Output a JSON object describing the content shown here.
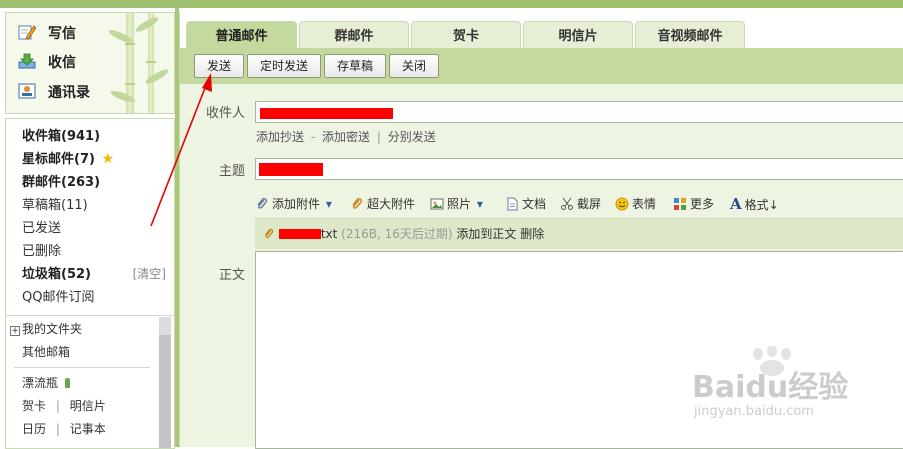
{
  "sidebar": {
    "quick": [
      {
        "label": "写信",
        "icon": "pencil-paper-icon"
      },
      {
        "label": "收信",
        "icon": "inbox-download-icon"
      },
      {
        "label": "通讯录",
        "icon": "contacts-card-icon"
      }
    ],
    "folders": [
      {
        "label": "收件箱(941)",
        "bold": true
      },
      {
        "label": "星标邮件(7)",
        "bold": true,
        "icon": "star-icon"
      },
      {
        "label": "群邮件(263)",
        "bold": true
      },
      {
        "label": "草稿箱(11)",
        "bold": false
      },
      {
        "label": "已发送",
        "bold": false
      },
      {
        "label": "已删除",
        "bold": false
      },
      {
        "label": "垃圾箱(52)",
        "bold": true,
        "action": "[清空]"
      },
      {
        "label": "QQ邮件订阅",
        "bold": false
      }
    ],
    "my_folders": "我的文件夹",
    "my_folders_icon": "expand-plus-icon",
    "other_mailbox": "其他邮箱",
    "drift_bottle": "漂流瓶",
    "drift_bottle_icon": "bottle-icon",
    "links_row1": [
      "贺卡",
      "明信片"
    ],
    "links_row2": [
      "日历",
      "记事本"
    ]
  },
  "tabs": [
    {
      "label": "普通邮件",
      "active": true
    },
    {
      "label": "群邮件",
      "active": false
    },
    {
      "label": "贺卡",
      "active": false
    },
    {
      "label": "明信片",
      "active": false
    },
    {
      "label": "音视频邮件",
      "active": false
    }
  ],
  "toolbar": {
    "send": "发送",
    "scheduled_send": "定时发送",
    "save_draft": "存草稿",
    "close": "关闭"
  },
  "form": {
    "recipient_label": "收件人",
    "recipient_links": [
      "添加抄送",
      "添加密送",
      "分别发送"
    ],
    "recipient_links_sep": [
      "-",
      "|"
    ],
    "subject_label": "主题",
    "body_label": "正文"
  },
  "editor_toolbar": [
    {
      "label": "添加附件",
      "icon": "paperclip-icon",
      "dropdown": true
    },
    {
      "label": "超大附件",
      "icon": "big-paperclip-icon"
    },
    {
      "label": "照片",
      "icon": "photo-icon",
      "dropdown": true
    },
    {
      "label": "文档",
      "icon": "document-icon"
    },
    {
      "label": "截屏",
      "icon": "scissors-icon"
    },
    {
      "label": "表情",
      "icon": "smiley-icon"
    },
    {
      "label": "更多",
      "icon": "grid-icon"
    },
    {
      "label": "格式",
      "icon": "text-format-icon",
      "suffix": "↓"
    }
  ],
  "attachment": {
    "name_suffix": "txt",
    "meta": "(216B, 16天后过期)",
    "add_to_body": "添加到正文",
    "delete": "删除"
  },
  "watermark": {
    "brand": "Baidu经验",
    "url": "jingyan.baidu.com"
  }
}
